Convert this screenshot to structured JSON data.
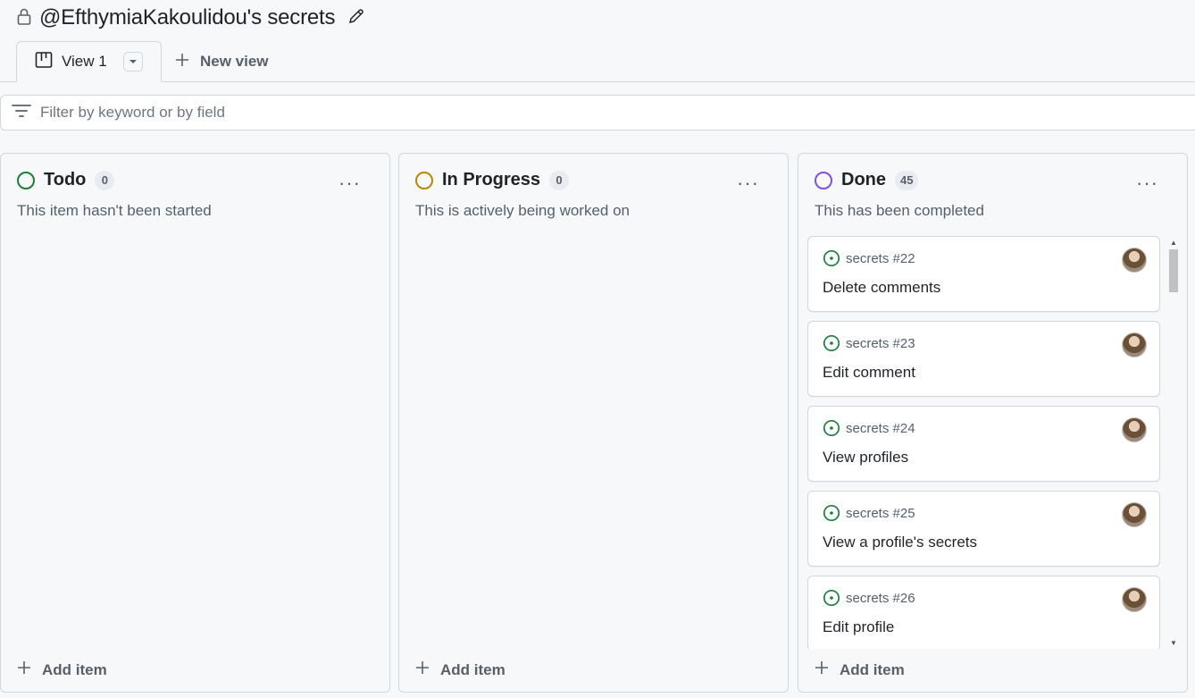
{
  "header": {
    "title": "@EfthymiaKakoulidou's secrets",
    "lock_icon": "lock-icon",
    "edit_icon": "pencil-icon"
  },
  "tabs": {
    "active": {
      "label": "View 1",
      "icon": "board-icon"
    },
    "new_view_label": "New view"
  },
  "filter": {
    "placeholder": "Filter by keyword or by field",
    "value": ""
  },
  "columns": [
    {
      "name": "Todo",
      "count": "0",
      "description": "This item hasn't been started",
      "color": "#1a7f37",
      "add_label": "Add item",
      "menu": "···"
    },
    {
      "name": "In Progress",
      "count": "0",
      "description": "This is actively being worked on",
      "color": "#bf8700",
      "add_label": "Add item",
      "menu": "···"
    },
    {
      "name": "Done",
      "count": "45",
      "description": "This has been completed",
      "color": "#8250df",
      "add_label": "Add item",
      "menu": "···",
      "cards": [
        {
          "ref": "secrets #22",
          "title": "Delete comments"
        },
        {
          "ref": "secrets #23",
          "title": "Edit comment"
        },
        {
          "ref": "secrets #24",
          "title": "View profiles"
        },
        {
          "ref": "secrets #25",
          "title": "View a profile's secrets"
        },
        {
          "ref": "secrets #26",
          "title": "Edit profile"
        }
      ]
    }
  ],
  "colors": {
    "issue_open": "#1a7f37",
    "border": "#d0d7de",
    "muted": "#57606a"
  }
}
